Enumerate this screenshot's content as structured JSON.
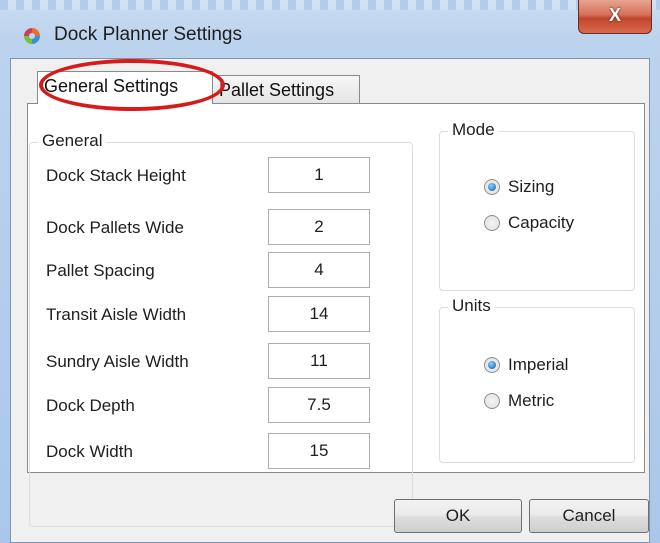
{
  "window": {
    "title": "Dock Planner Settings",
    "close_label": "X"
  },
  "tabs": [
    {
      "label": "General Settings",
      "active": true
    },
    {
      "label": "Pallet Settings",
      "active": false
    }
  ],
  "general": {
    "group_label": "General",
    "fields": [
      {
        "label": "Dock Stack Height",
        "value": "1"
      },
      {
        "label": "Dock Pallets Wide",
        "value": "2"
      },
      {
        "label": "Pallet Spacing",
        "value": "4"
      },
      {
        "label": "Transit Aisle Width",
        "value": "14"
      },
      {
        "label": "Sundry Aisle Width",
        "value": "11"
      },
      {
        "label": "Dock Depth",
        "value": "7.5"
      },
      {
        "label": "Dock Width",
        "value": "15"
      }
    ]
  },
  "mode": {
    "group_label": "Mode",
    "options": [
      {
        "label": "Sizing",
        "checked": true
      },
      {
        "label": "Capacity",
        "checked": false
      }
    ]
  },
  "units": {
    "group_label": "Units",
    "options": [
      {
        "label": "Imperial",
        "checked": true
      },
      {
        "label": "Metric",
        "checked": false
      }
    ]
  },
  "buttons": {
    "ok_label": "OK",
    "cancel_label": "Cancel"
  },
  "colors": {
    "highlight": "#d61b1b",
    "radio_accent": "#1f6fb8",
    "close_button": "#c2452c"
  },
  "icons": {
    "app": "dock-planner-app-icon",
    "close": "close-icon"
  }
}
